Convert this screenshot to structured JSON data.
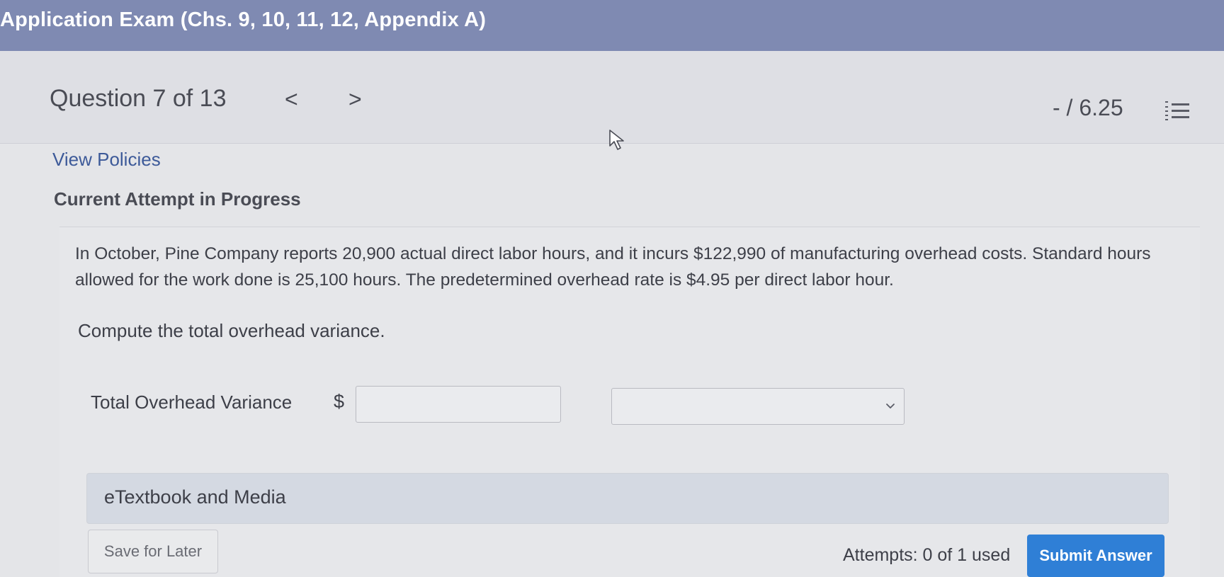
{
  "exam": {
    "title": "Application Exam (Chs. 9, 10, 11, 12, Appendix A)"
  },
  "question_nav": {
    "label": "Question 7 of 13",
    "prev_icon": "chevron-left-icon",
    "next_icon": "chevron-right-icon",
    "prev_glyph": "<",
    "next_glyph": ">",
    "score": "- / 6.25",
    "list_icon": "list-icon"
  },
  "links": {
    "view_policies": "View Policies"
  },
  "status": {
    "attempt": "Current Attempt in Progress"
  },
  "question": {
    "text": "In October, Pine Company reports 20,900 actual direct labor hours, and it incurs $122,990 of manufacturing overhead costs. Standard hours allowed for the work done is 25,100 hours. The predetermined overhead rate is $4.95 per direct labor hour.",
    "prompt": "Compute the total overhead variance."
  },
  "answer": {
    "field_label": "Total Overhead Variance",
    "currency_symbol": "$",
    "amount_value": "",
    "select_value": ""
  },
  "resources": {
    "etextbook_label": "eTextbook and Media"
  },
  "footer": {
    "save_label": "Save for Later",
    "attempts_text": "Attempts: 0 of 1 used",
    "submit_label": "Submit Answer"
  },
  "colors": {
    "title_bar": "#7f8ab2",
    "link": "#3d5a99",
    "submit": "#2f7fd6"
  }
}
